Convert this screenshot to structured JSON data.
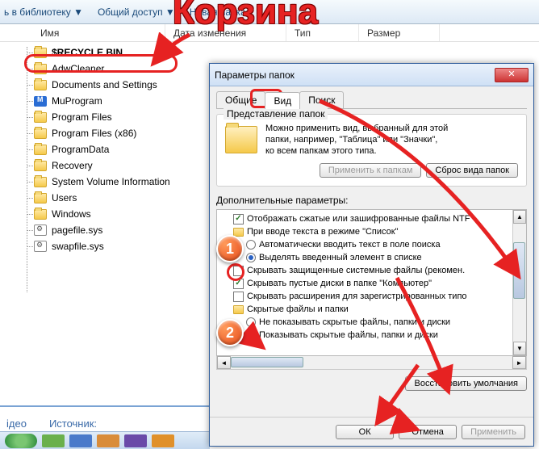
{
  "annotation_title": "Корзина",
  "toolbar": {
    "library": "ь в библиотеку ▼",
    "share": "Общий доступ ▼",
    "new_folder": "Новая папка"
  },
  "columns": {
    "name": "Имя",
    "date": "Дата изменения",
    "type": "Тип",
    "size": "Размер"
  },
  "files": [
    {
      "icon": "folder",
      "name": "$RECYCLE.BIN"
    },
    {
      "icon": "folder",
      "name": "AdwCleaner"
    },
    {
      "icon": "folder",
      "name": "Documents and Settings"
    },
    {
      "icon": "prog",
      "name": "MuProgram"
    },
    {
      "icon": "folder",
      "name": "Program Files"
    },
    {
      "icon": "folder",
      "name": "Program Files (x86)"
    },
    {
      "icon": "folder",
      "name": "ProgramData"
    },
    {
      "icon": "folder",
      "name": "Recovery"
    },
    {
      "icon": "folder",
      "name": "System Volume Information"
    },
    {
      "icon": "folder",
      "name": "Users"
    },
    {
      "icon": "winfolder",
      "name": "Windows"
    },
    {
      "icon": "sys",
      "name": "pagefile.sys"
    },
    {
      "icon": "sys",
      "name": "swapfile.sys"
    }
  ],
  "dialog": {
    "title": "Параметры папок",
    "tabs": {
      "general": "Общие",
      "view": "Вид",
      "search": "Поиск"
    },
    "group_title": "Представление папок",
    "group_text_1": "Можно применить вид, выбранный для этой",
    "group_text_2": "папки, например, \"Таблица\" или \"Значки\",",
    "group_text_3": "ко всем папкам этого типа.",
    "apply_to_folders": "Применить к папкам",
    "reset_view": "Сброс вида папок",
    "params_label": "Дополнительные параметры:",
    "tree": {
      "r1": "Отображать сжатые или зашифрованные файлы NTF",
      "r2": "При вводе текста в режиме \"Список\"",
      "r3": "Автоматически вводить текст в поле поиска",
      "r4": "Выделять введенный элемент в списке",
      "r5": "Скрывать защищенные системные файлы (рекомен.",
      "r6": "Скрывать пустые диски в папке \"Компьютер\"",
      "r7": "Скрывать расширения для зарегистрированных типо",
      "r8": "Скрытые файлы и папки",
      "r9": "Не показывать скрытые файлы, папки и диски",
      "r10": "Показывать скрытые файлы, папки и диски"
    },
    "restore_defaults": "Восстановить умолчания",
    "ok": "ОК",
    "cancel": "Отмена",
    "apply": "Применить"
  },
  "bottom": {
    "video": "ідео",
    "source": "Источник:"
  },
  "badges": {
    "one": "1",
    "two": "2"
  }
}
